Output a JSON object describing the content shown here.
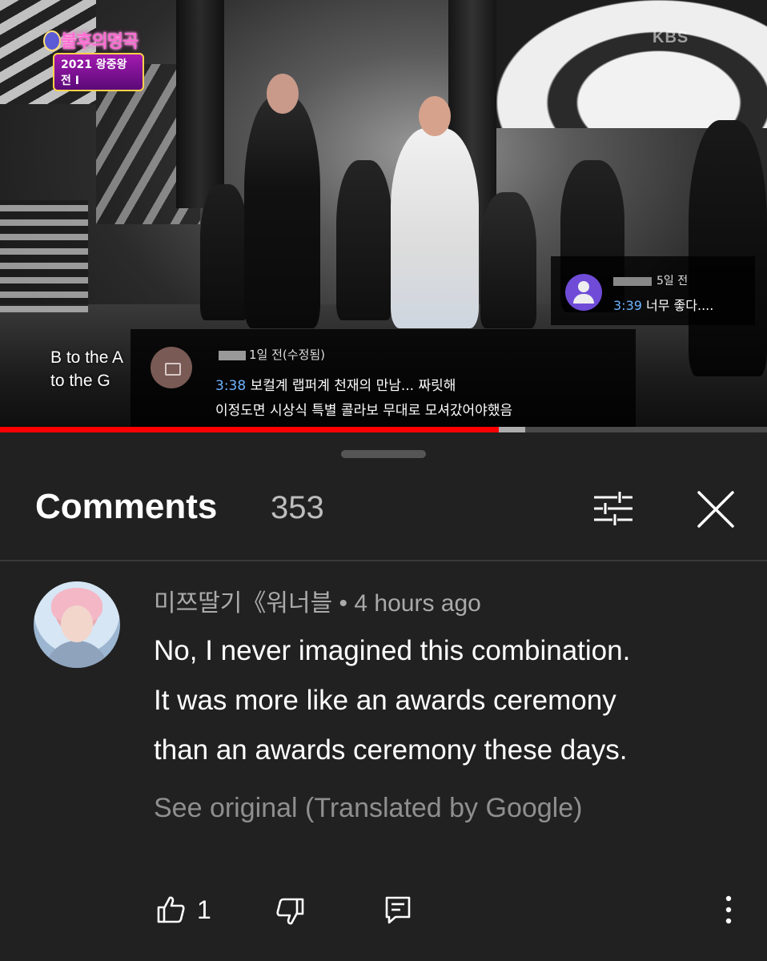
{
  "video": {
    "show_logo_title": "불후의명곡",
    "show_logo_subtitle": "2021 왕중왕전 I",
    "broadcaster": "KBS",
    "subtitle_lines": [
      "B to the A",
      "to the G"
    ],
    "progress_fraction": 0.65,
    "buffered_fraction": 0.685,
    "overlay_comment_1": {
      "name": "5일 전",
      "timestamp": "3:39",
      "text": "너무 좋다...."
    },
    "overlay_comment_2": {
      "name": "1일 전(수정됨)",
      "timestamp": "3:38",
      "line1": "보컬계 랩퍼계 천재의 만남... 짜릿해",
      "line2": "이정도면 시상식 특별 콜라보 무대로 모셔갔어야했음"
    }
  },
  "comments": {
    "title": "Comments",
    "count": "353",
    "icons": {
      "filter": "filter-sliders-icon",
      "close": "close-icon"
    }
  },
  "comment": {
    "author": "미쯔딸기《워너블",
    "separator": "•",
    "time": "4 hours ago",
    "lines": [
      "No, I never imagined this combination.",
      "It was more like an awards ceremony",
      "than an awards ceremony these days."
    ],
    "translate_link": "See original (Translated by Google)",
    "like_count": "1",
    "icons": {
      "like": "thumbs-up-icon",
      "dislike": "thumbs-down-icon",
      "reply": "reply-icon",
      "more": "more-vertical-icon"
    }
  },
  "colors": {
    "background": "#212121",
    "progress_played": "#ff0000",
    "timestamp_link": "#6db3ff",
    "secondary_text": "#aaaaaa"
  }
}
